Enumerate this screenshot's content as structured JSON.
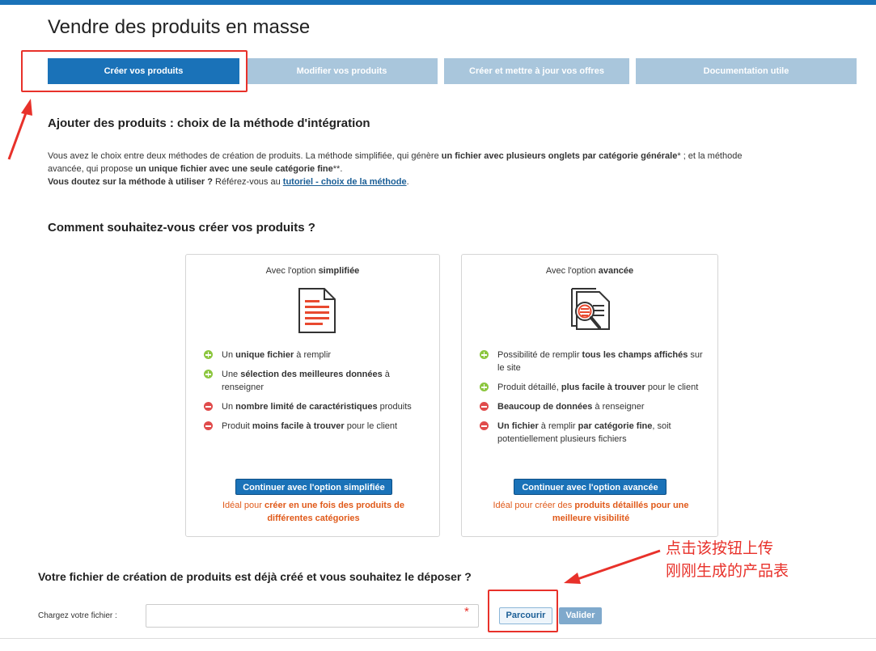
{
  "page": {
    "title": "Vendre des produits en masse"
  },
  "tabs": [
    {
      "label": "Créer vos produits",
      "active": true
    },
    {
      "label": "Modifier vos produits",
      "active": false
    },
    {
      "label": "Créer et mettre à jour vos offres",
      "active": false
    },
    {
      "label": "Documentation utile",
      "active": false
    }
  ],
  "intro": {
    "heading": "Ajouter des produits : choix de la méthode d'intégration",
    "p1_a": "Vous avez le choix entre deux méthodes de création de produits. La méthode simplifiée, qui génère ",
    "p1_b": "un fichier avec plusieurs onglets par catégorie générale",
    "p1_c": "* ; et la méthode avancée, qui propose ",
    "p1_d": "un unique fichier avec une seule catégorie fine",
    "p1_e": "**.",
    "p2_a": "Vous doutez sur la méthode à utiliser ?",
    "p2_b": " Référez-vous au ",
    "p2_link": "tutoriel - choix de la méthode",
    "p2_c": "."
  },
  "method": {
    "heading": "Comment souhaitez-vous créer vos produits ?",
    "cards": [
      {
        "title_a": "Avec l'option ",
        "title_b": "simplifiée",
        "icon": "document-icon",
        "items": [
          {
            "type": "plus",
            "parts": [
              "Un ",
              "unique fichier",
              " à remplir"
            ]
          },
          {
            "type": "plus",
            "parts": [
              "Une ",
              "sélection des meilleures données",
              " à renseigner"
            ]
          },
          {
            "type": "minus",
            "parts": [
              "Un ",
              "nombre limité de caractéristiques",
              " produits"
            ]
          },
          {
            "type": "minus",
            "parts": [
              "Produit ",
              "moins facile à trouver",
              " pour le client"
            ]
          }
        ],
        "cta": "Continuer avec l'option simplifiée",
        "note_a": "Idéal pour ",
        "note_b": "créer en une fois des produits de différentes catégories",
        "note_c": ""
      },
      {
        "title_a": "Avec l'option ",
        "title_b": "avancée",
        "icon": "document-search-icon",
        "items": [
          {
            "type": "plus",
            "parts": [
              "Possibilité de remplir ",
              "tous les champs affichés",
              " sur le site"
            ]
          },
          {
            "type": "plus",
            "parts": [
              "Produit détaillé, ",
              "plus facile à trouver",
              " pour le client"
            ]
          },
          {
            "type": "minus",
            "parts": [
              "",
              "Beaucoup de données",
              " à renseigner"
            ]
          },
          {
            "type": "minus",
            "parts": [
              "",
              "Un fichier",
              " à remplir ",
              "par catégorie fine",
              ", soit potentiellement plusieurs fichiers"
            ]
          }
        ],
        "cta": "Continuer avec l'option avancée",
        "note_a": "Idéal pour créer des ",
        "note_b": "produits détaillés pour une meilleure visibilité",
        "note_c": ""
      }
    ]
  },
  "upload": {
    "heading": "Votre fichier de création de produits est déjà créé et vous souhaitez le déposer ?",
    "label": "Chargez votre fichier :",
    "value": "",
    "required_mark": "*",
    "browse": "Parcourir",
    "submit": "Valider"
  },
  "annotation": {
    "line1": "点击该按钮上传",
    "line2": "刚刚生成的产品表",
    "color": "#e8312a"
  },
  "colors": {
    "accent": "#1a72b8",
    "tab_inactive": "#a9c6dc",
    "note": "#e05a1a",
    "plus": "#8cc63f",
    "minus": "#e04b4b"
  }
}
